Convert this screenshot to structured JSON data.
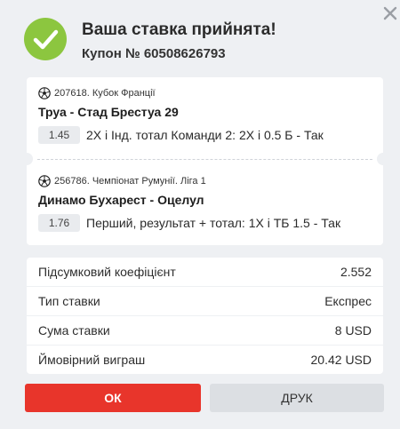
{
  "colors": {
    "accent": "#e8352b",
    "success": "#8cc63f",
    "secondary_button": "#dcdfe3"
  },
  "dialog": {
    "title": "Ваша ставка прийнята!",
    "coupon": "Купон № 60508626793",
    "close_icon": "close-icon",
    "success_icon": "check-circle-icon"
  },
  "bets": [
    {
      "meta": "207618. Кубок Франції",
      "teams": "Труа - Стад Брестуа 29",
      "odds": "1.45",
      "outcome": "2X і Інд. тотал Команди 2: 2X і 0.5 Б - Так",
      "icon": "soccer-ball-icon"
    },
    {
      "meta": "256786. Чемпіонат Румунії. Ліга 1",
      "teams": "Динамо Бухарест - Оцелул",
      "odds": "1.76",
      "outcome": "Перший, результат + тотал: 1Х і ТБ 1.5 - Так",
      "icon": "soccer-ball-icon"
    }
  ],
  "summary": [
    {
      "label": "Підсумковий коефіцієнт",
      "value": "2.552"
    },
    {
      "label": "Тип ставки",
      "value": "Експрес"
    },
    {
      "label": "Сума ставки",
      "value": "8 USD"
    },
    {
      "label": "Ймовірний виграш",
      "value": "20.42 USD"
    }
  ],
  "buttons": {
    "ok": "ОК",
    "print": "ДРУК"
  }
}
